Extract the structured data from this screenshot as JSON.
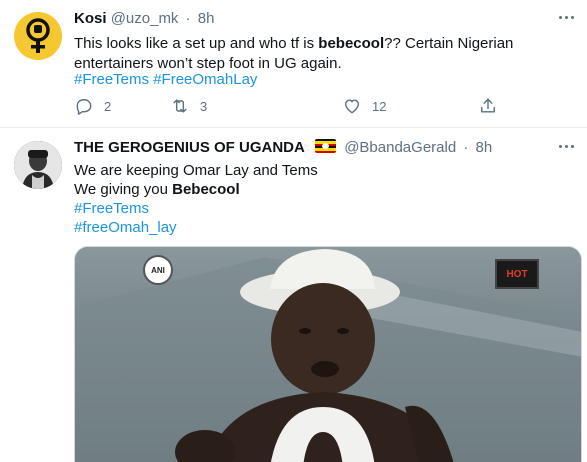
{
  "tweets": [
    {
      "name": "Kosi",
      "handle": "@uzo_mk",
      "time": "8h",
      "text_before": "This looks like a set up and who tf is ",
      "text_bold": "bebecool",
      "text_after": "?? Certain Nigerian entertainers won’t step foot in UG again.",
      "hashtags": "#FreeTems #FreeOmahLay",
      "reply_count": "2",
      "retweet_count": "3",
      "like_count": "12"
    },
    {
      "name": "THE GEROGENIUS OF UGANDA",
      "handle": "@BbandaGerald",
      "time": "8h",
      "line1": "We are keeping Omar Lay and Tems",
      "line2_prefix": "We giving you ",
      "line2_bold": "Bebecool",
      "hashtag1": "#FreeTems",
      "hashtag2": "#freeOmah_lay",
      "media_badge_left": "ANI",
      "media_badge_right": "HOT"
    }
  ],
  "colors": {
    "link": "#1b95e0",
    "secondary_text": "#5b7083",
    "avatar_kosi": "#f5c832"
  },
  "icons": [
    "venus-fist-icon",
    "more-icon",
    "reply-icon",
    "retweet-icon",
    "like-icon",
    "share-icon",
    "uganda-flag-icon"
  ]
}
